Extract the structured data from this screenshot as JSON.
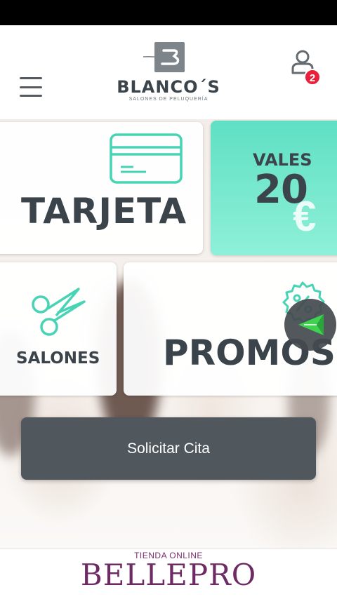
{
  "header": {
    "logo_name": "BLANCO´S",
    "logo_tagline": "SALONES DE PELUQUERÍA",
    "notification_count": "2"
  },
  "cards": {
    "tarjeta": {
      "title": "TARJETA",
      "icon": "credit-card-icon"
    },
    "vales": {
      "label": "VALES",
      "amount": "20",
      "currency": "€"
    },
    "salones": {
      "title": "SALONES",
      "icon": "scissors-icon"
    },
    "promos": {
      "title": "PROMOS",
      "icon": "percent-badge-icon"
    }
  },
  "cta": {
    "label": "Solicitar Cita"
  },
  "footer": {
    "caption": "TIENDA ONLINE",
    "brand": "BELLEPRO"
  },
  "colors": {
    "accent_teal": "#5fe0c3",
    "dark_text": "#3c444b",
    "button_bg": "#50575d",
    "badge_red": "#e8203a",
    "brand_purple": "#6d2a63"
  }
}
